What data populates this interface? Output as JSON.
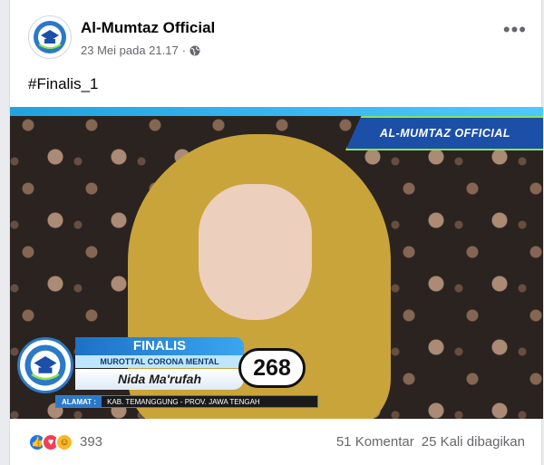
{
  "post": {
    "page_name": "Al-Mumtaz Official",
    "timestamp": "23 Mei pada 21.17",
    "separator": "·",
    "audience_icon": "globe-icon",
    "text": "#Finalis_1"
  },
  "video": {
    "banner": "AL-MUMTAZ OFFICIAL",
    "lower_third": {
      "title": "FINALIS",
      "subtitle": "MUROTTAL CORONA MENTAL",
      "name": "Nida Ma'rufah",
      "number": "268",
      "address_label": "ALAMAT :",
      "address_value": "KAB. TEMANGGUNG - PROV. JAWA TENGAH"
    }
  },
  "footer": {
    "reaction_count": "393",
    "comments": "51 Komentar",
    "shares": "25 Kali dibagikan"
  },
  "colors": {
    "brand_blue": "#1877f2",
    "banner_blue": "#1c4fa8",
    "accent_green": "#8ee34a",
    "hijab": "#c9a43a"
  }
}
